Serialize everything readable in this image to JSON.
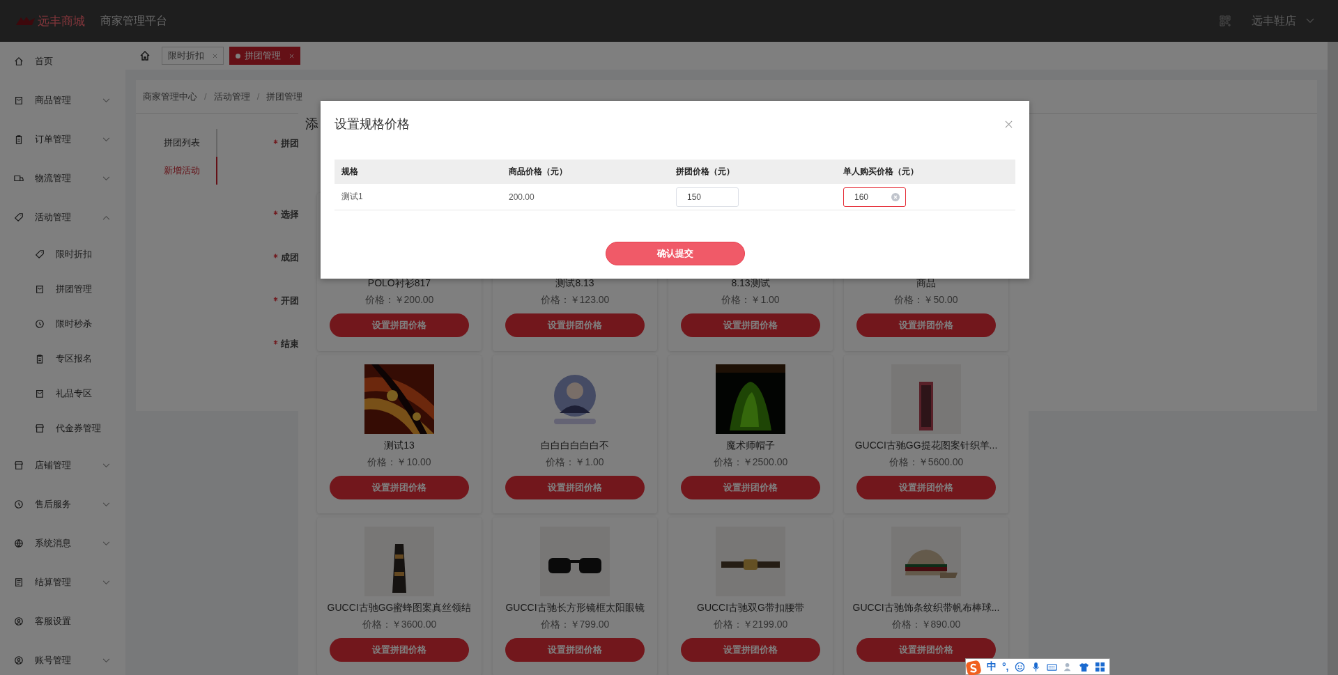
{
  "header": {
    "logo": "远丰商城",
    "title": "商家管理平台",
    "shop": "远丰鞋店"
  },
  "sidebar": {
    "items": [
      {
        "label": "首页",
        "kind": "link"
      },
      {
        "label": "商品管理",
        "kind": "group",
        "expanded": false
      },
      {
        "label": "订单管理",
        "kind": "group",
        "expanded": false
      },
      {
        "label": "物流管理",
        "kind": "group",
        "expanded": false
      },
      {
        "label": "活动管理",
        "kind": "group",
        "expanded": true,
        "children": [
          {
            "label": "限时折扣"
          },
          {
            "label": "拼团管理"
          },
          {
            "label": "限时秒杀"
          },
          {
            "label": "专区报名"
          },
          {
            "label": "礼品专区"
          },
          {
            "label": "代金券管理"
          }
        ]
      },
      {
        "label": "店铺管理",
        "kind": "group",
        "expanded": false
      },
      {
        "label": "售后服务",
        "kind": "group",
        "expanded": false
      },
      {
        "label": "系统消息",
        "kind": "group",
        "expanded": false
      },
      {
        "label": "结算管理",
        "kind": "group",
        "expanded": false
      },
      {
        "label": "客服设置",
        "kind": "link"
      },
      {
        "label": "账号管理",
        "kind": "group",
        "expanded": false
      }
    ]
  },
  "tabs": [
    {
      "label": "限时折扣",
      "selected": false
    },
    {
      "label": "拼团管理",
      "selected": true
    }
  ],
  "breadcrumb": {
    "items": [
      "商家管理中心",
      "活动管理",
      "拼团管理"
    ],
    "separator": "/"
  },
  "side_tabs": [
    {
      "label": "拼团列表",
      "selected": false
    },
    {
      "label": "新增活动",
      "selected": true
    }
  ],
  "form_labels": [
    {
      "label": "拼团",
      "required": true
    },
    {
      "label": "选择",
      "required": true
    },
    {
      "label": "成团",
      "required": true
    },
    {
      "label": "开团",
      "required": true
    },
    {
      "label": "结束",
      "required": true
    }
  ],
  "product_dialog": {
    "title": "添",
    "products": [
      {
        "name": "POLO衬衫817",
        "price": "价格：￥200.00",
        "button": "设置拼团价格"
      },
      {
        "name": "测试8.13",
        "price": "价格：￥123.00",
        "button": "设置拼团价格"
      },
      {
        "name": "8.13测试",
        "price": "价格：￥1.00",
        "button": "设置拼团价格"
      },
      {
        "name": "商品",
        "price": "价格：￥50.00",
        "button": "设置拼团价格"
      },
      {
        "kind": "picture",
        "name": "测试13",
        "price": "价格：￥10.00",
        "button": "设置拼团价格"
      },
      {
        "kind": "picture",
        "name": "白白白白白白不",
        "price": "价格：￥1.00",
        "button": "设置拼团价格"
      },
      {
        "kind": "picture",
        "name": "魔术师帽子",
        "price": "价格：￥2500.00",
        "button": "设置拼团价格"
      },
      {
        "kind": "picture",
        "name": "GUCCI古驰GG提花图案针织羊...",
        "price": "价格：￥5600.00",
        "button": "设置拼团价格"
      },
      {
        "kind": "picture",
        "name": "GUCCI古驰GG蜜蜂图案真丝领结",
        "price": "价格：￥3600.00",
        "button": "设置拼团价格"
      },
      {
        "kind": "picture",
        "name": "GUCCI古驰长方形镜框太阳眼镜",
        "price": "价格：￥799.00",
        "button": "设置拼团价格"
      },
      {
        "kind": "picture",
        "name": "GUCCI古驰双G带扣腰带",
        "price": "价格：￥2199.00",
        "button": "设置拼团价格"
      },
      {
        "kind": "picture",
        "name": "GUCCI古驰饰条纹织带帆布棒球...",
        "price": "价格：￥890.00",
        "button": "设置拼团价格"
      }
    ]
  },
  "price_modal": {
    "title": "设置规格价格",
    "columns": [
      "规格",
      "商品价格（元）",
      "拼团价格（元）",
      "单人购买价格（元）"
    ],
    "rows": [
      {
        "cells": [
          {
            "kind": "text",
            "value": "测试1"
          },
          {
            "kind": "text",
            "value": "200.00"
          },
          {
            "kind": "input",
            "value": "150",
            "focused": false
          },
          {
            "kind": "input",
            "value": "160",
            "focused": true
          }
        ]
      }
    ],
    "submit": "确认提交"
  },
  "ime_toolbar": {
    "mode": "中",
    "punctuation": "°,"
  }
}
